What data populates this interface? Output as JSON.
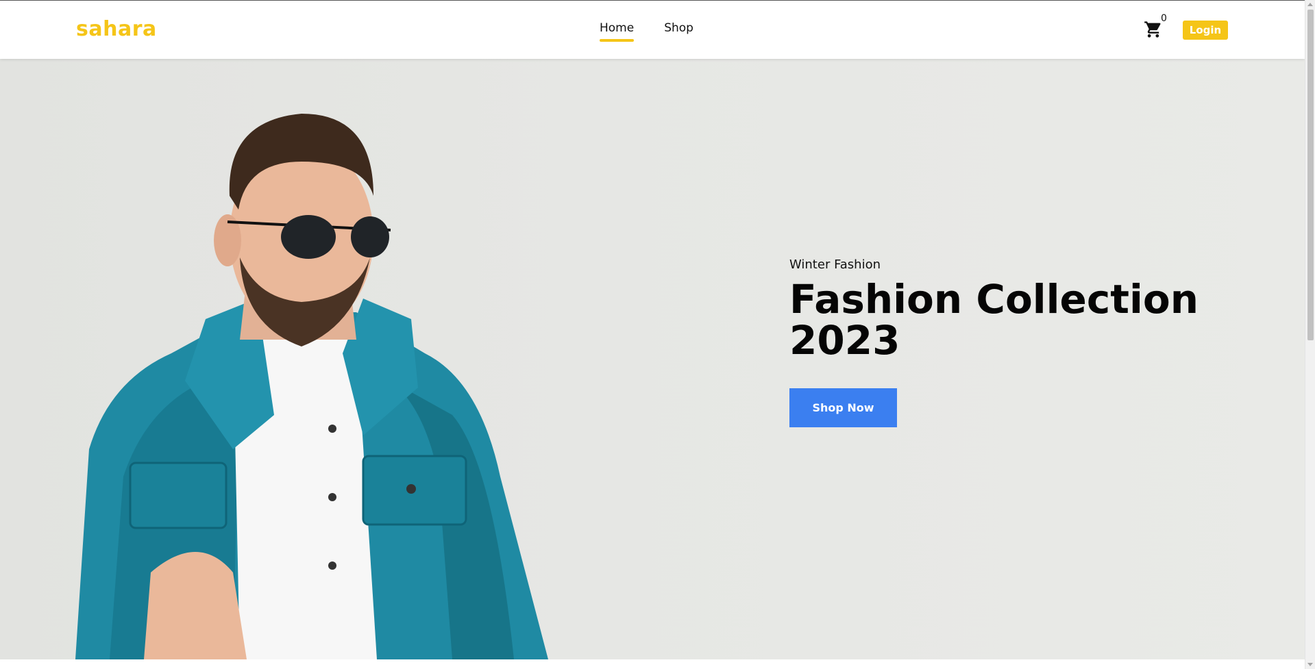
{
  "brand": {
    "logo_text": "sahara",
    "accent_color": "#f5c518"
  },
  "nav": {
    "items": [
      {
        "label": "Home",
        "active": true
      },
      {
        "label": "Shop",
        "active": false
      }
    ]
  },
  "cart": {
    "icon": "cart-icon",
    "count": "0"
  },
  "auth": {
    "login_label": "Login"
  },
  "hero": {
    "subtitle": "Winter Fashion",
    "headline": "Fashion Collection 2023",
    "cta_label": "Shop Now",
    "cta_color": "#3b7ff0",
    "image": "man-in-denim-jacket-and-sunglasses"
  }
}
